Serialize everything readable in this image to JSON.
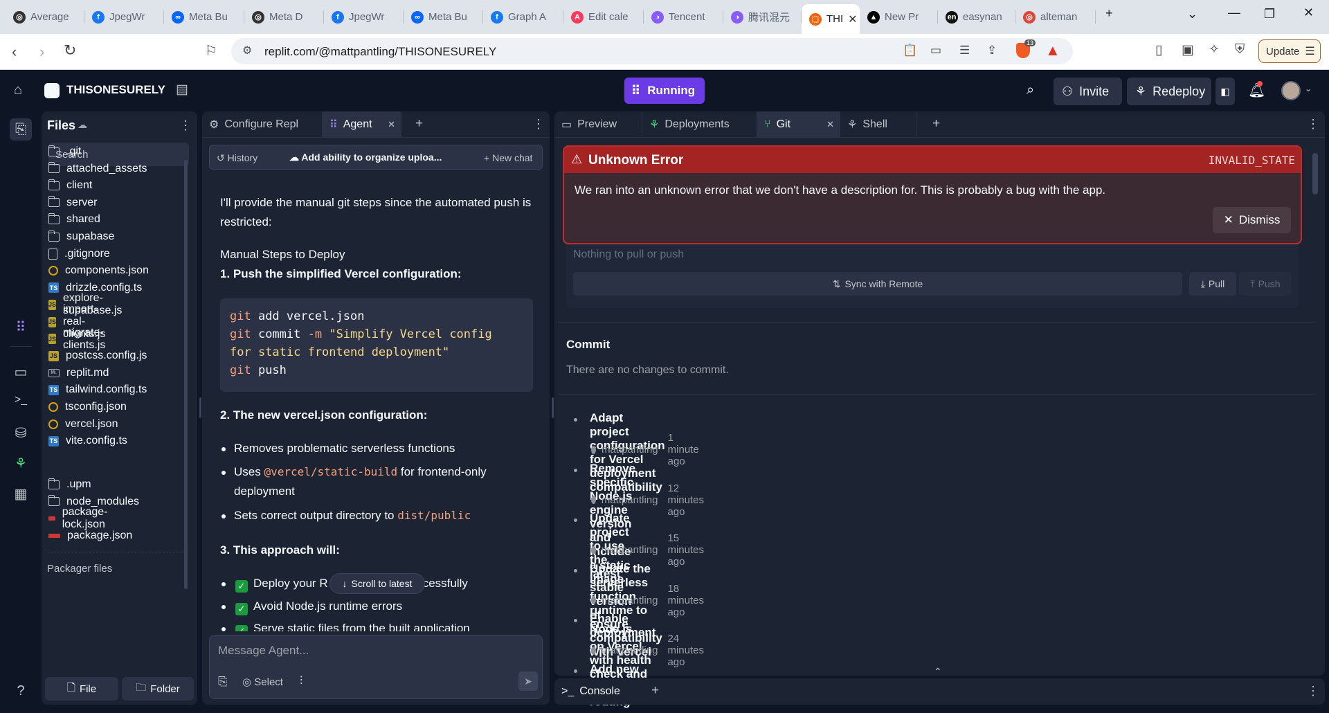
{
  "browser": {
    "tabs": [
      {
        "label": "Average",
        "color": "#333333",
        "glyph": "◎"
      },
      {
        "label": "JpegWr",
        "color": "#1877f2",
        "glyph": "f"
      },
      {
        "label": "Meta Bu",
        "color": "#0866ff",
        "glyph": "∞"
      },
      {
        "label": "Meta D",
        "color": "#333333",
        "glyph": "◎"
      },
      {
        "label": "JpegWr",
        "color": "#1877f2",
        "glyph": "f"
      },
      {
        "label": "Meta Bu",
        "color": "#0866ff",
        "glyph": "∞"
      },
      {
        "label": "Graph A",
        "color": "#1877f2",
        "glyph": "f"
      },
      {
        "label": "Edit cale",
        "color": "#ff385c",
        "glyph": "A"
      },
      {
        "label": "Tencent",
        "color": "#8a5cf6",
        "glyph": "◑"
      },
      {
        "label": "腾讯混元",
        "color": "#8a5cf6",
        "glyph": "◑"
      },
      {
        "label": "THI",
        "color": "#f26207",
        "glyph": "⬚",
        "active": true
      },
      {
        "label": "New Pr",
        "color": "#000000",
        "glyph": "▲"
      },
      {
        "label": "easynan",
        "color": "#111111",
        "glyph": "en"
      },
      {
        "label": "alteman",
        "color": "#e0453a",
        "glyph": "◎"
      }
    ],
    "url": "replit.com/@mattpantling/THISONESURELY",
    "shield_count": "13",
    "update_label": "Update"
  },
  "replit": {
    "project_name": "THISONESURELY",
    "run_label": "Running",
    "invite_label": "Invite",
    "redeploy_label": "Redeploy"
  },
  "files": {
    "title": "Files",
    "search_placeholder": "Search",
    "items": [
      {
        "name": ".git",
        "type": "folder"
      },
      {
        "name": "attached_assets",
        "type": "folder"
      },
      {
        "name": "client",
        "type": "folder"
      },
      {
        "name": "server",
        "type": "folder"
      },
      {
        "name": "shared",
        "type": "folder"
      },
      {
        "name": "supabase",
        "type": "folder"
      },
      {
        "name": ".gitignore",
        "type": "file"
      },
      {
        "name": "components.json",
        "type": "json"
      },
      {
        "name": "drizzle.config.ts",
        "type": "ts"
      },
      {
        "name": "explore-supabase.js",
        "type": "js"
      },
      {
        "name": "import-real-clients.js",
        "type": "js"
      },
      {
        "name": "migrate-clients.js",
        "type": "js"
      },
      {
        "name": "postcss.config.js",
        "type": "js"
      },
      {
        "name": "replit.md",
        "type": "md"
      },
      {
        "name": "tailwind.config.ts",
        "type": "ts"
      },
      {
        "name": "tsconfig.json",
        "type": "json"
      },
      {
        "name": "vercel.json",
        "type": "json"
      },
      {
        "name": "vite.config.ts",
        "type": "ts"
      }
    ],
    "packager_title": "Packager files",
    "packager_items": [
      {
        "name": ".upm",
        "type": "folder"
      },
      {
        "name": "node_modules",
        "type": "folder"
      },
      {
        "name": "package-lock.json",
        "type": "npm"
      },
      {
        "name": "package.json",
        "type": "npm"
      }
    ],
    "new_file_label": "File",
    "new_folder_label": "Folder"
  },
  "agent_panel": {
    "tabs": [
      "Configure Repl",
      "Agent"
    ],
    "history_label": "History",
    "thread_title": "Add ability to organize uploa...",
    "new_chat_label": "New chat",
    "intro": "I'll provide the manual git steps since the automated push is restricted:",
    "manual_heading": "Manual Steps to Deploy",
    "step1": "1. Push the simplified Vercel configuration:",
    "code_lines": [
      [
        {
          "t": "git",
          "c": "kw"
        },
        {
          "t": " add vercel.json",
          "c": ""
        }
      ],
      [
        {
          "t": "git",
          "c": "kw"
        },
        {
          "t": " commit ",
          "c": ""
        },
        {
          "t": "-m",
          "c": "kw"
        },
        {
          "t": " \"Simplify Vercel config",
          "c": "str"
        }
      ],
      [
        {
          "t": "for static frontend deployment\"",
          "c": "str"
        }
      ],
      [
        {
          "t": "git",
          "c": "kw"
        },
        {
          "t": " push",
          "c": ""
        }
      ]
    ],
    "step2": "2. The new vercel.json configuration:",
    "bullet1": "Removes problematic serverless functions",
    "bullet2_pre": "Uses",
    "bullet2_code": "@vercel/static-build",
    "bullet2_post": "for frontend-only deployment",
    "bullet3_pre": "Sets correct output directory to",
    "bullet3_code": "dist/public",
    "step3": "3. This approach will:",
    "check1_pre": "Deploy your R",
    "check1_post": "cessfully",
    "check2": "Avoid Node.js runtime errors",
    "check3": "Serve static files from the built application",
    "scroll_latest": "Scroll to latest",
    "input_placeholder": "Message Agent...",
    "select_label": "Select"
  },
  "git_panel": {
    "tabs": [
      "Preview",
      "Deployments",
      "Git",
      "Shell"
    ],
    "error_title": "Unknown Error",
    "error_code": "INVALID_STATE",
    "error_message": "We ran into an unknown error that we don't have a description for. This is probably a bug with the app.",
    "dismiss_label": "Dismiss",
    "nothing_text": "Nothing to pull or push",
    "sync_label": "Sync with Remote",
    "pull_label": "Pull",
    "push_label": "Push",
    "commit_heading": "Commit",
    "no_changes": "There are no changes to commit.",
    "commits": [
      {
        "title": "Adapt project configuration for Vercel deployment compatibility",
        "author": "mattpantling",
        "time": "1 minute ago"
      },
      {
        "title": "Remove specific Node.js engine version and include a static image",
        "author": "mattpantling",
        "time": "12 minutes ago"
      },
      {
        "title": "Update project to use the latest stable version of Node.js",
        "author": "mattpantling",
        "time": "15 minutes ago"
      },
      {
        "title": "Update the serverless function runtime to ensure compatibility with Vercel",
        "author": "mattpantling",
        "time": "18 minutes ago"
      },
      {
        "title": "Enable deployment on Vercel with health check and basic API routing",
        "author": "mattpantling",
        "time": "24 minutes ago"
      },
      {
        "title": "Add new visual asset to enhance the platform's image library",
        "author": "",
        "time": ""
      }
    ],
    "console_label": "Console"
  }
}
